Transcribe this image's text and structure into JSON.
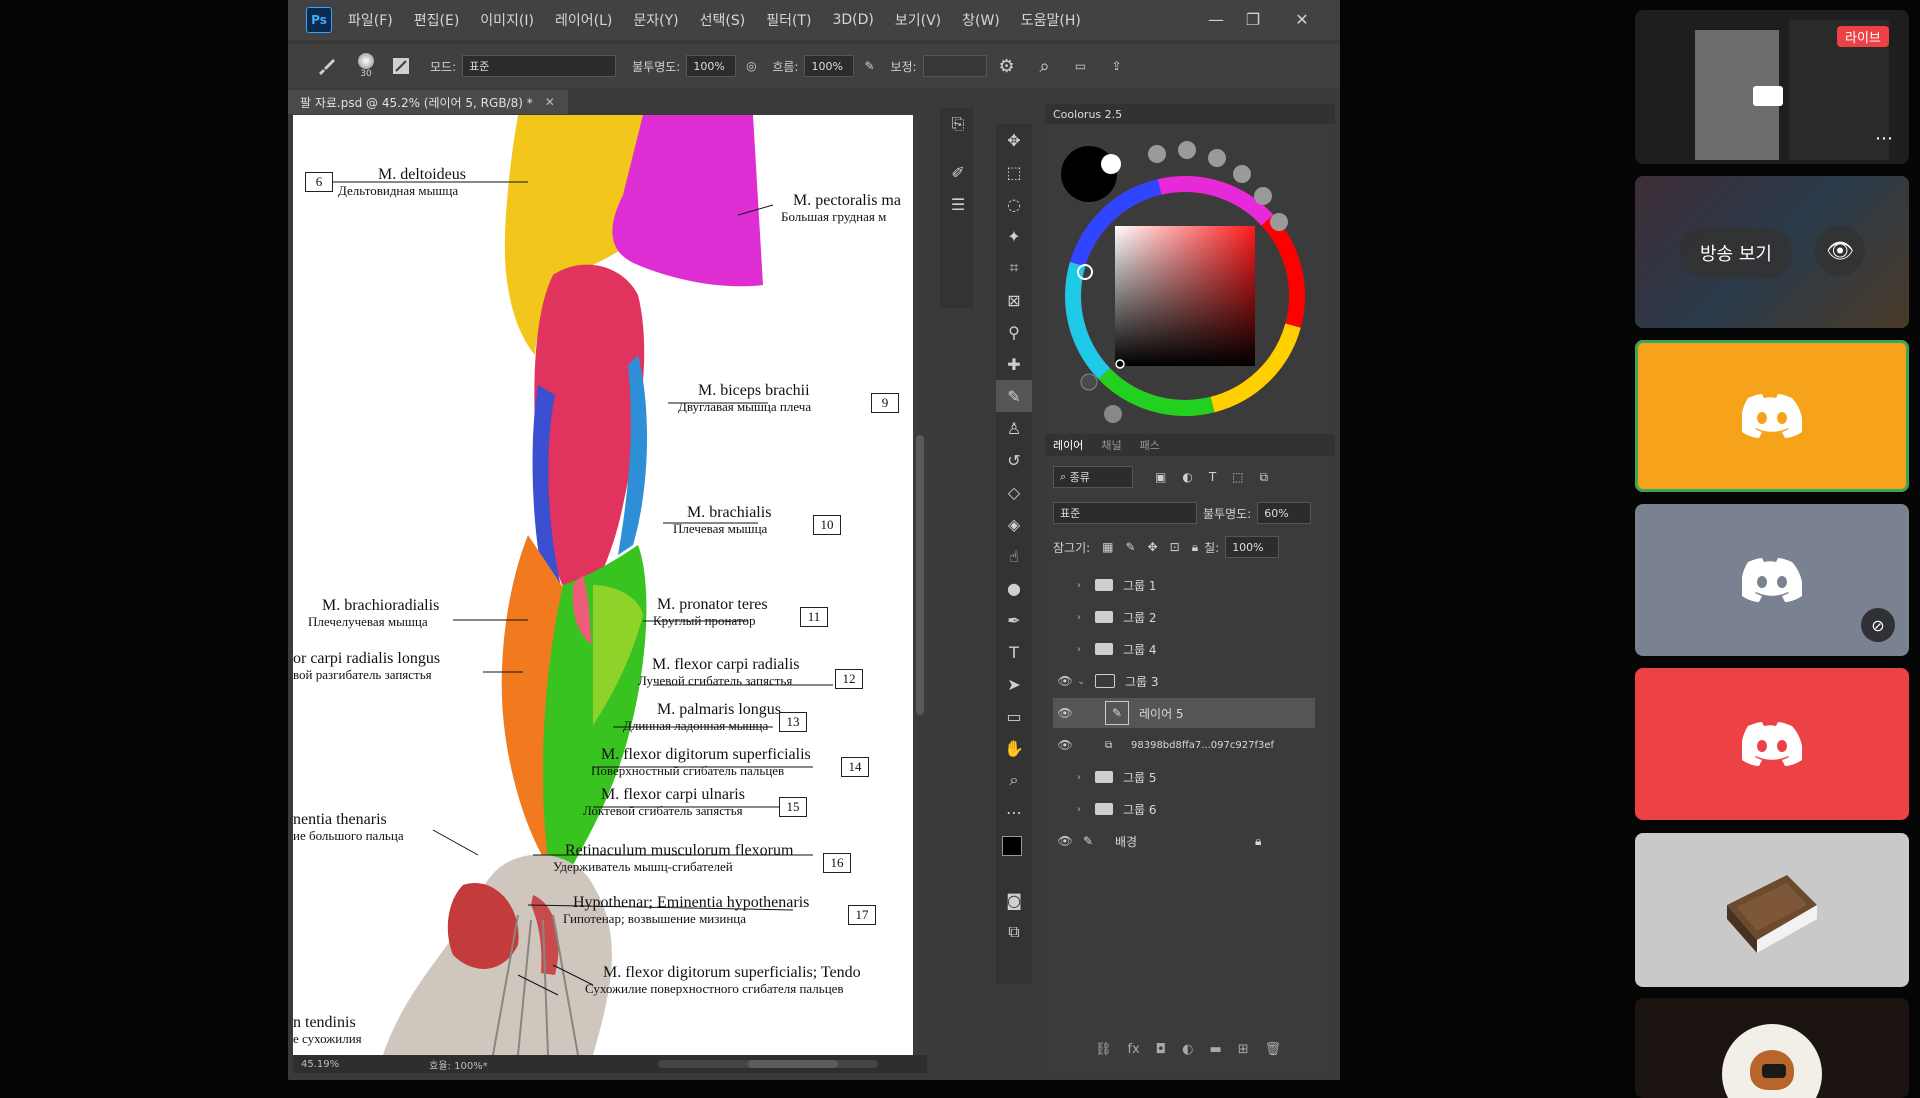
{
  "photoshop": {
    "logo": "Ps",
    "menu": [
      "파일(F)",
      "편집(E)",
      "이미지(I)",
      "레이어(L)",
      "문자(Y)",
      "선택(S)",
      "필터(T)",
      "3D(D)",
      "보기(V)",
      "창(W)",
      "도움말(H)"
    ],
    "options": {
      "brush_size": "30",
      "mode_label": "모드:",
      "mode_value": "표준",
      "opacity_label": "불투명도:",
      "opacity_value": "100%",
      "flow_label": "흐름:",
      "flow_value": "100%",
      "smoothing_label": "보정:"
    },
    "document_tab": "팔 자료.psd @ 45.2% (레이어 5, RGB/8) *",
    "status": {
      "zoom": "45.19%",
      "info": "효율: 100%*"
    },
    "anatomy_labels": [
      {
        "lat": "M. deltoideus",
        "ru": "Дельтовидная мышца"
      },
      {
        "lat": "M. pectoralis ma",
        "ru": "Большая грудная м"
      },
      {
        "lat": "M. biceps brachii",
        "ru": "Двуглавая мышца плеча"
      },
      {
        "lat": "M. brachialis",
        "ru": "Плечевая мышца"
      },
      {
        "lat": "M. brachioradialis",
        "ru": "Плечелучевая мышца"
      },
      {
        "lat": "M. pronator teres",
        "ru": "Круглый пронатор"
      },
      {
        "lat": "or carpi radialis longus",
        "ru": "вой разгибатель запястья"
      },
      {
        "lat": "M. flexor carpi radialis",
        "ru": "Лучевой сгибатель запястья"
      },
      {
        "lat": "M. palmaris longus",
        "ru": "Длинная ладонная мышца"
      },
      {
        "lat": "M. flexor digitorum superficialis",
        "ru": "Поверхностный сгибатель пальцев"
      },
      {
        "lat": "M. flexor carpi ulnaris",
        "ru": "Локтевой сгибатель запястья"
      },
      {
        "lat": "nentia thenaris",
        "ru": "ие большого пальца"
      },
      {
        "lat": "Retinaculum musculorum flexorum",
        "ru": "Удерживатель мышц-сгибателей"
      },
      {
        "lat": "Hypothenar; Eminentia hypothenaris",
        "ru": "Гипотенар; возвышение мизинца"
      },
      {
        "lat": "M. flexor digitorum superficialis; Tendo",
        "ru": "Сухожилие поверхностного сгибателя пальцев"
      },
      {
        "lat": "n tendinis",
        "ru": "е сухожилия"
      }
    ],
    "anatomy_numbers": [
      "6",
      "9",
      "10",
      "11",
      "12",
      "13",
      "14",
      "15",
      "16",
      "17"
    ],
    "color_panel": {
      "title": "Coolorus 2.5"
    },
    "layers_panel": {
      "tabs": [
        "레이어",
        "채널",
        "패스"
      ],
      "kind_filter": "종류",
      "blend_mode": "표준",
      "opacity_label": "불투명도:",
      "opacity_value": "60%",
      "lock_label": "잠그기:",
      "fill_label": "칠:",
      "fill_value": "100%",
      "layers": [
        {
          "name": "그룹 1",
          "visible": false,
          "type": "group"
        },
        {
          "name": "그룹 2",
          "visible": false,
          "type": "group"
        },
        {
          "name": "그룹 4",
          "visible": false,
          "type": "group"
        },
        {
          "name": "그룹 3",
          "visible": true,
          "type": "group-open"
        },
        {
          "name": "레이어 5",
          "visible": true,
          "type": "layer"
        },
        {
          "name": "98398bd8ffa7...097c927f3ef",
          "visible": true,
          "type": "smart"
        },
        {
          "name": "그룹 5",
          "visible": false,
          "type": "group"
        },
        {
          "name": "그룹 6",
          "visible": false,
          "type": "group"
        },
        {
          "name": "배경",
          "visible": true,
          "type": "background"
        }
      ]
    }
  },
  "discord": {
    "live_badge": "라이브",
    "watch_stream": "방송 보기",
    "tiles": [
      {
        "kind": "stream-preview",
        "color": "#1e1e1e"
      },
      {
        "kind": "broadcast",
        "color": "#2a2a2a"
      },
      {
        "kind": "avatar",
        "color": "#f6a31b",
        "speaking": true
      },
      {
        "kind": "avatar",
        "color": "#7a8191",
        "muted": true
      },
      {
        "kind": "avatar",
        "color": "#ec4245"
      },
      {
        "kind": "custom",
        "color": "#c9c9c9"
      },
      {
        "kind": "custom",
        "color": "#1b1410"
      }
    ]
  }
}
